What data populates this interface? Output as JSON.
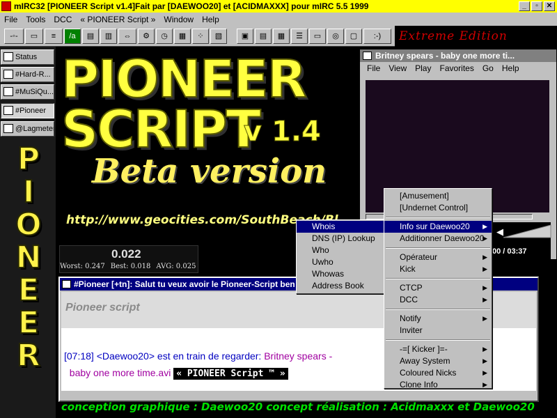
{
  "titlebar": {
    "text": "mIRC32 [PIONEER Script v1.4]Fait par [DAEWOO20] et [ACIDMAXXX] pour mIRC 5.5 1999",
    "buttons": [
      "_",
      "▫",
      "✕"
    ]
  },
  "menubar": [
    "File",
    "Tools",
    "DCC",
    "« PIONEER Script »",
    "Window",
    "Help"
  ],
  "toolbar": {
    "badge": "Extreme Edition",
    "smiley": ":-)"
  },
  "switchbar": [
    "Status",
    "#Hard-R...",
    "#MuSiQu...",
    "#Pioneer",
    "@Lagmeter"
  ],
  "vertical_logo": "PIONEER",
  "banner": {
    "title_line1": "PIONEER",
    "title_line2": "SCRIPT",
    "version": "v 1.4",
    "beta": "Beta version",
    "url": "http://www.geocities.com/SouthBeach/Bl..."
  },
  "lagmeter": {
    "value": "0.022",
    "worst": "Worst: 0.247",
    "best": "Best: 0.018",
    "avg": "AVG: 0.025"
  },
  "player": {
    "title": "Britney spears - baby one more ti...",
    "menu": [
      "File",
      "View",
      "Play",
      "Favorites",
      "Go",
      "Help"
    ],
    "time": "00 / 03:37"
  },
  "chatwin": {
    "title": "#Pioneer [+tn]: Salut tu veux avoir le Pioneer-Script ben",
    "header": "Pioneer script",
    "timestamp": "[07:18]",
    "nick": "<Daewoo20>",
    "action": "est en train de regarder:",
    "movie_line1": "Britney spears -",
    "movie_line2": "baby one more time.avi",
    "badge": "« PIONEER Script ™ »"
  },
  "menu_left": [
    "Whois",
    "DNS (IP) Lookup",
    "Who",
    "Uwho",
    "Whowas",
    "Address Book"
  ],
  "menu_right": {
    "group1": [
      "[Amusement]",
      "[Undernet Control]"
    ],
    "group2": [
      "Info sur Daewoo20",
      "Additionner Daewoo20"
    ],
    "group3": [
      "Opérateur",
      "Kick"
    ],
    "group4": [
      "CTCP",
      "DCC"
    ],
    "group5": [
      "Notify",
      "Inviter"
    ],
    "group6": [
      "-=[ Kicker ]=-",
      "Away System",
      "Coloured Nicks",
      "Clone Info"
    ]
  },
  "credits": "conception graphique : Daewoo20  concept réalisation : Acidmaxxx et Daewoo20",
  "colors": {
    "titlebar": "#ffff00",
    "menu_selected": "#000080",
    "logo": "#ffff40",
    "credits": "#00e000"
  }
}
